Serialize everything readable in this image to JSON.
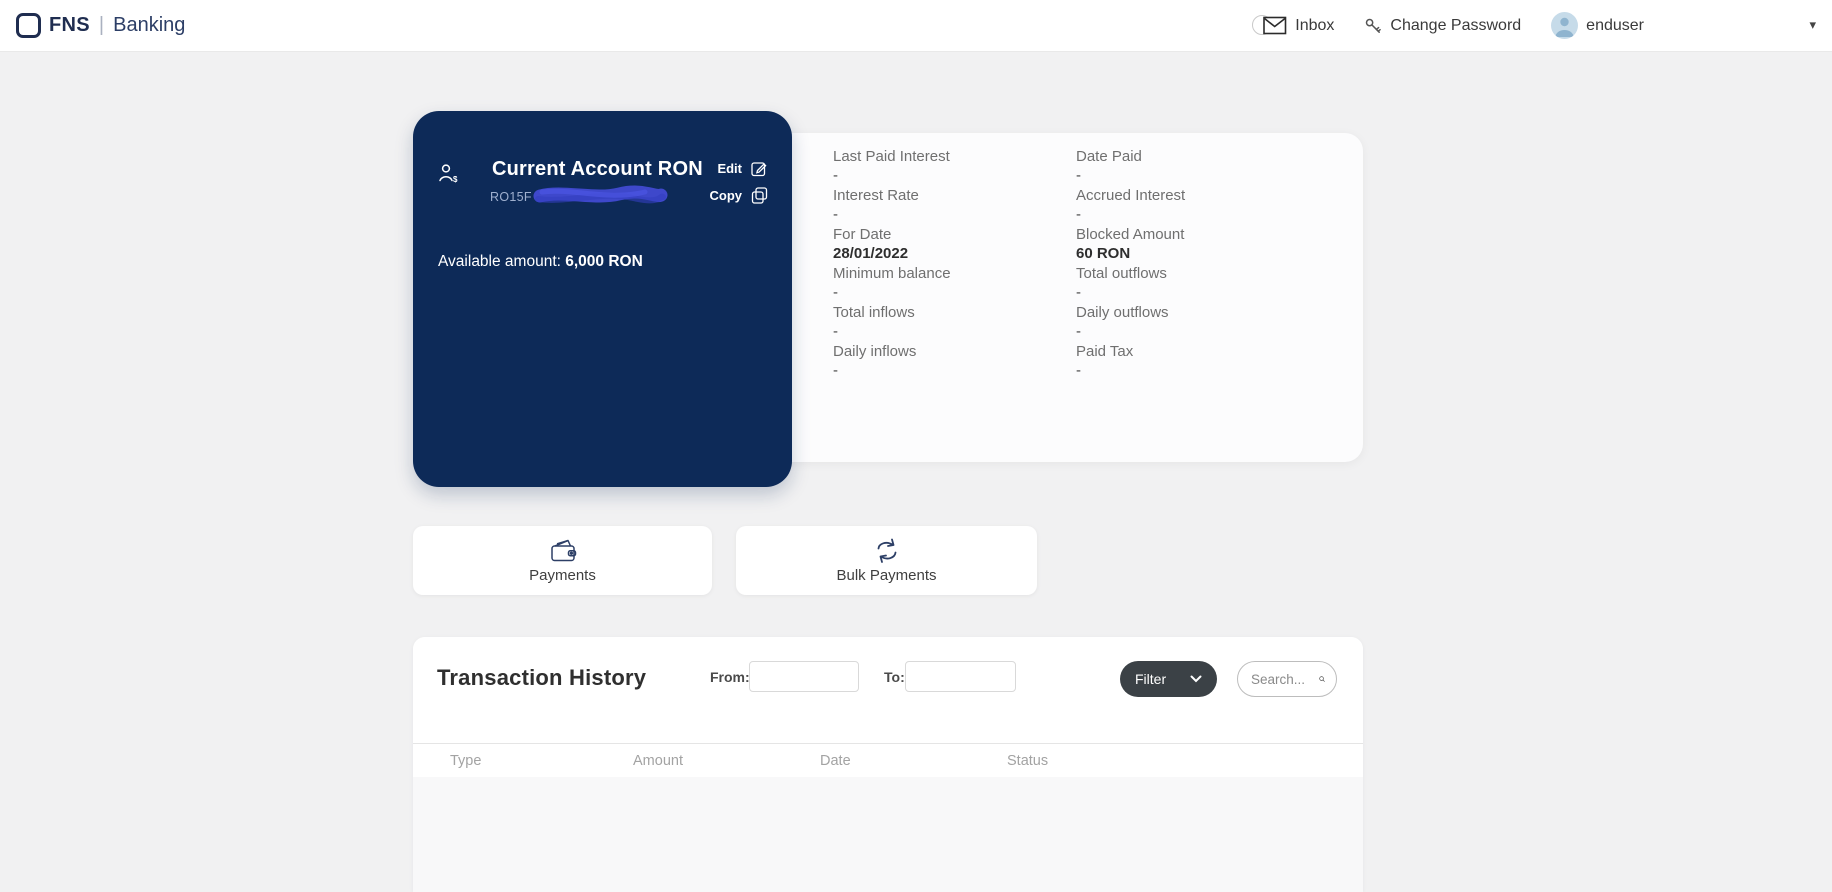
{
  "navbar": {
    "brand": {
      "name": "FNS",
      "divider": "|",
      "suffix": "Banking"
    },
    "inbox_label": "Inbox",
    "change_password_label": "Change Password",
    "username": "enduser",
    "caret": "▾"
  },
  "account_card": {
    "title": "Current Account RON",
    "iban_prefix": "RO15F",
    "edit_label": "Edit",
    "copy_label": "Copy",
    "available_label": "Available amount:",
    "available_amount": "6,000 RON"
  },
  "details": {
    "cells": [
      {
        "label": "Last Paid Interest",
        "value": "-"
      },
      {
        "label": "Date Paid",
        "value": "-"
      },
      {
        "label": "Interest Rate",
        "value": "-"
      },
      {
        "label": "Accrued Interest",
        "value": "-"
      },
      {
        "label": "For Date",
        "value": "28/01/2022"
      },
      {
        "label": "Blocked Amount",
        "value": "60 RON"
      },
      {
        "label": "Minimum balance",
        "value": "-"
      },
      {
        "label": "Total outflows",
        "value": "-"
      },
      {
        "label": "Total inflows",
        "value": "-"
      },
      {
        "label": "Daily outflows",
        "value": "-"
      },
      {
        "label": "Daily inflows",
        "value": "-"
      },
      {
        "label": "Paid Tax",
        "value": "-"
      }
    ]
  },
  "actions": {
    "payments_label": "Payments",
    "bulk_payments_label": "Bulk Payments"
  },
  "transactions": {
    "title": "Transaction History",
    "from_label": "From:",
    "from_value": "",
    "to_label": "To:",
    "to_value": "",
    "filter_label": "Filter",
    "search_placeholder": "Search...",
    "columns": [
      "Type",
      "Amount",
      "Date",
      "Status"
    ],
    "rows": []
  },
  "colors": {
    "card_navy": "#0d2a58",
    "page_bg": "#f1f1f2",
    "filter_button": "#3b4146",
    "avatar_bg": "#c6dbe9",
    "avatar_fg": "#8fb4cf",
    "iban_scribble": "#414ad2",
    "icon_navy": "#2d3f66"
  }
}
